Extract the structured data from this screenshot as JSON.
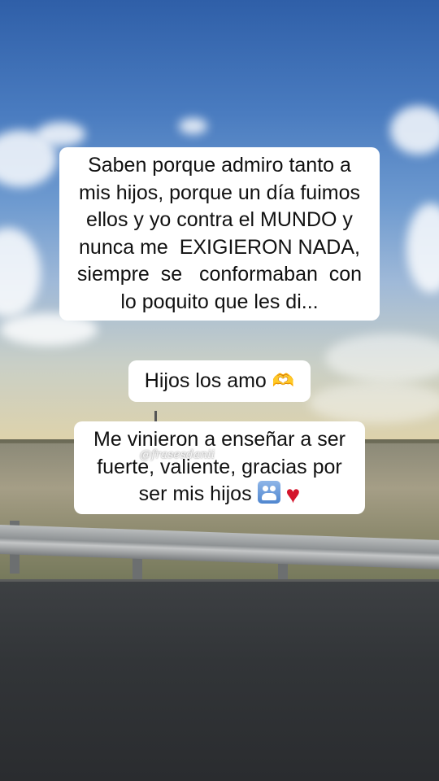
{
  "captions": [
    {
      "lines": [
        "Saben porque admiro tanto a",
        "mis hijos, porque un día fuimos",
        "ellos y yo contra el MUNDO y",
        "nunca me  EXIGIERON NADA,",
        "siempre  se   conformaban  con",
        "lo poquito que les di..."
      ]
    },
    {
      "text": "Hijos los amo",
      "emoji": "heart-hands"
    },
    {
      "lines": [
        "Me vinieron a enseñar a ser",
        "fuerte, valiente, gracias por",
        "ser mis hijos"
      ],
      "emojis": [
        "family-icon",
        "red-heart-icon"
      ]
    }
  ],
  "watermark": "@frasesdanii",
  "colors": {
    "caption_bg": "#ffffff",
    "caption_text": "#111111",
    "heart": "#d4152c"
  }
}
